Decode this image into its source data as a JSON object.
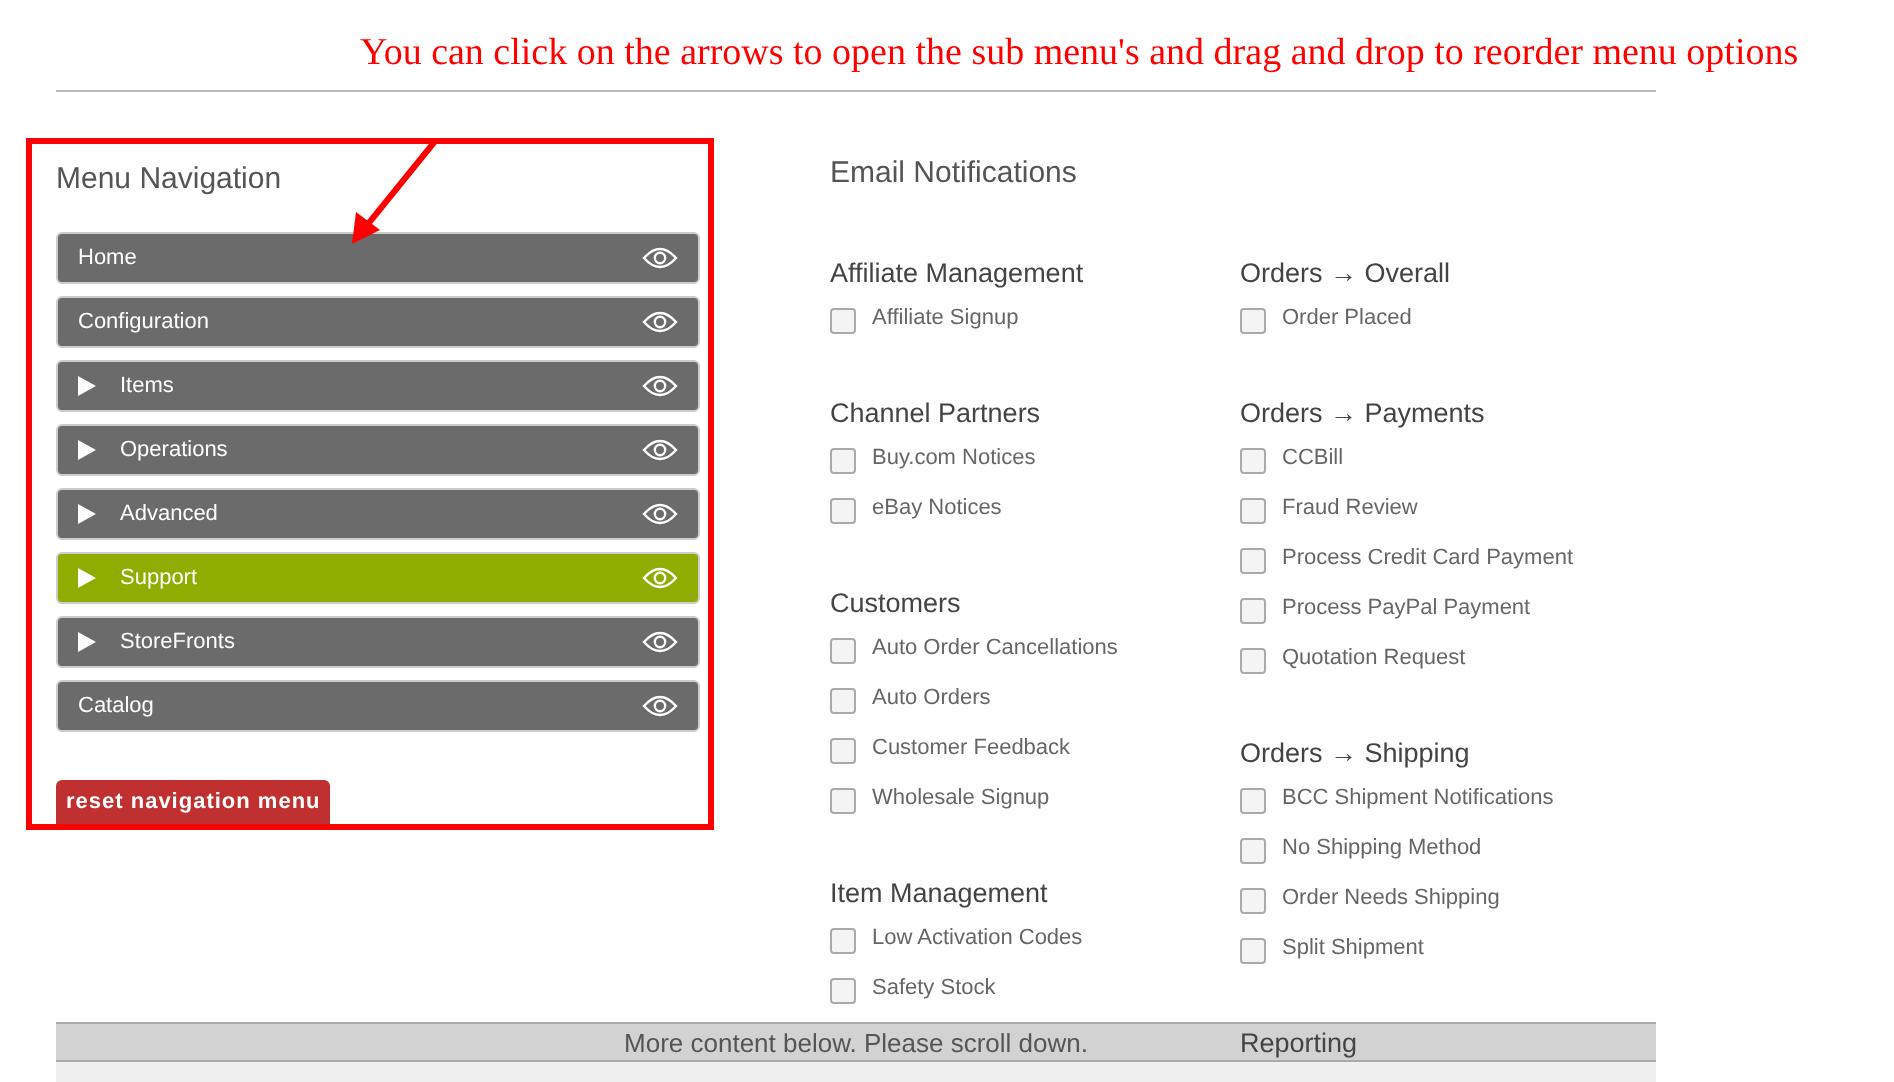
{
  "annotation": "You can click on the arrows to open the sub menu's and drag and drop to reorder menu options",
  "menu": {
    "title": "Menu Navigation",
    "items": [
      {
        "label": "Home",
        "kind": "leaf",
        "selected": false
      },
      {
        "label": "Configuration",
        "kind": "leaf",
        "selected": false
      },
      {
        "label": "Items",
        "kind": "folder",
        "selected": false
      },
      {
        "label": "Operations",
        "kind": "folder",
        "selected": false
      },
      {
        "label": "Advanced",
        "kind": "folder",
        "selected": false
      },
      {
        "label": "Support",
        "kind": "folder",
        "selected": true
      },
      {
        "label": "StoreFronts",
        "kind": "folder",
        "selected": false
      },
      {
        "label": "Catalog",
        "kind": "leaf",
        "selected": false
      }
    ],
    "reset_button": "reset navigation menu"
  },
  "email": {
    "title": "Email Notifications",
    "columns": [
      [
        {
          "heading": "Affiliate Management",
          "items": [
            {
              "label": "Affiliate Signup",
              "checked": false
            }
          ]
        },
        {
          "heading": "Channel Partners",
          "items": [
            {
              "label": "Buy.com Notices",
              "checked": false
            },
            {
              "label": "eBay Notices",
              "checked": false
            }
          ]
        },
        {
          "heading": "Customers",
          "items": [
            {
              "label": "Auto Order Cancellations",
              "checked": false
            },
            {
              "label": "Auto Orders",
              "checked": false
            },
            {
              "label": "Customer Feedback",
              "checked": false
            },
            {
              "label": "Wholesale Signup",
              "checked": false
            }
          ]
        },
        {
          "heading": "Item Management",
          "items": [
            {
              "label": "Low Activation Codes",
              "checked": false
            },
            {
              "label": "Safety Stock",
              "checked": false
            }
          ]
        }
      ],
      [
        {
          "heading": "Orders → Overall",
          "items": [
            {
              "label": "Order Placed",
              "checked": false
            }
          ]
        },
        {
          "heading": "Orders → Payments",
          "items": [
            {
              "label": "CCBill",
              "checked": false
            },
            {
              "label": "Fraud Review",
              "checked": false
            },
            {
              "label": "Process Credit Card Payment",
              "checked": false
            },
            {
              "label": "Process PayPal Payment",
              "checked": false
            },
            {
              "label": "Quotation Request",
              "checked": false
            }
          ]
        },
        {
          "heading": "Orders → Shipping",
          "items": [
            {
              "label": "BCC Shipment Notifications",
              "checked": false
            },
            {
              "label": "No Shipping Method",
              "checked": false
            },
            {
              "label": "Order Needs Shipping",
              "checked": false
            },
            {
              "label": "Split Shipment",
              "checked": false
            }
          ]
        },
        {
          "heading": "Reporting"
        }
      ]
    ]
  },
  "scroll_notice": "More content below. Please scroll down."
}
